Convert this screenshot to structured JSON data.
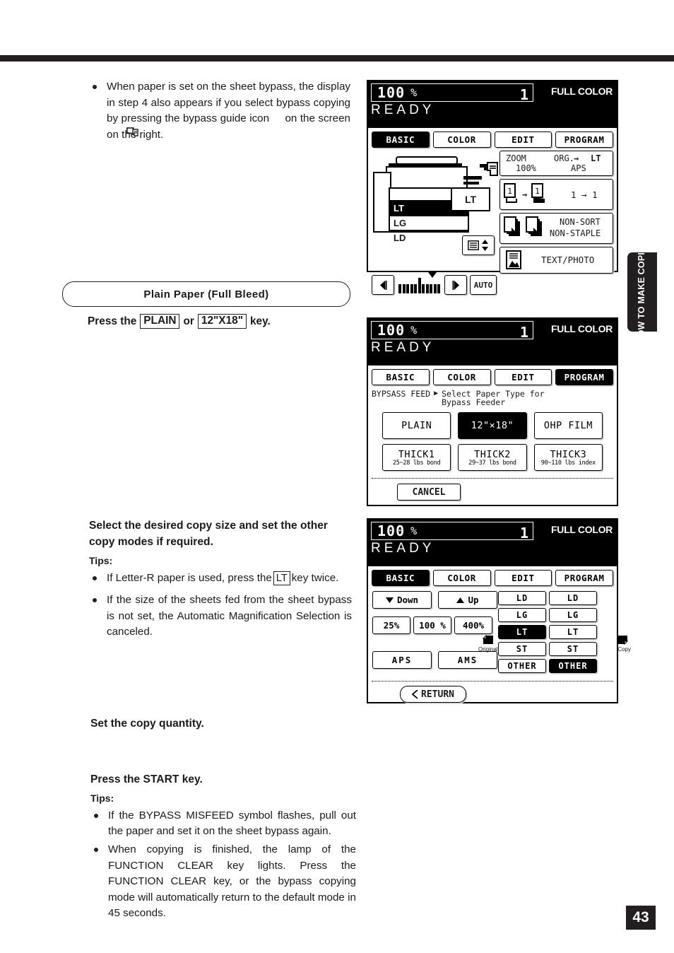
{
  "page": {
    "number": "43",
    "side_tab": "HOW TO MAKE COPIES"
  },
  "notes": {
    "note1": "When paper is set on the sheet bypass, the display in step 4 also appears if you select bypass copying by pressing the bypass guide icon     on the screen on the right."
  },
  "section": {
    "pill_title": "Plain Paper (Full Bleed)",
    "press_prefix": "Press the",
    "key1": "PLAIN",
    "press_or": "or",
    "key2": "12\"X18\"",
    "press_suffix": "key."
  },
  "steps": {
    "select_size": {
      "heading": "Select the desired copy size and set the other copy modes if required.",
      "tips_label": "Tips:",
      "tip1_a": "If Letter-R paper is used, press the",
      "tip1_key": "LT",
      "tip1_b": "key twice.",
      "tip2": "If the size of the sheets fed from the sheet bypass is not set, the Automatic Magnification Selection is canceled."
    },
    "quantity": {
      "heading": "Set the copy quantity."
    },
    "start": {
      "heading": "Press the START key.",
      "tips_label": "Tips:",
      "tip1": "If the BYPASS MISFEED symbol flashes, pull out the paper and set it on the sheet bypass again.",
      "tip2": "When copying is finished, the lamp of the FUNCTION CLEAR key lights.  Press the FUNCTION CLEAR key, or the bypass copying mode will automatically return to the default mode in 45 seconds."
    }
  },
  "lcd_common": {
    "ratio": "100",
    "percent": "%",
    "quantity": "1",
    "color_mode": "FULL COLOR",
    "status": "READY",
    "tabs": [
      "BASIC",
      "COLOR",
      "EDIT",
      "PROGRAM"
    ]
  },
  "lcd1": {
    "selected_tab": "BASIC",
    "trays": [
      "",
      "LT",
      "LG",
      "LD"
    ],
    "selected_tray": "LT",
    "bypass_size": "LT",
    "zoom_label": "ZOOM",
    "zoom_value": "100%",
    "org_label": "ORG.",
    "org_arrow": "→",
    "org_target": "LT",
    "aps_label": "APS",
    "duplex_value": "1 → 1",
    "duplex_icon_left": "1",
    "duplex_icon_right": "1",
    "finisher_line1": "NON-SORT",
    "finisher_line2": "NON-STAPLE",
    "orig_mode": "TEXT/PHOTO",
    "auto_label": "AUTO"
  },
  "lcd2": {
    "selected_tab": "PROGRAM",
    "breadcrumb": "BYPSASS FEED",
    "breadcrumb_arrow": "▶",
    "breadcrumb_detail_line1": "Select Paper Type for",
    "breadcrumb_detail_line2": "Bypass Feeder",
    "paper_types": [
      {
        "label": "PLAIN",
        "sub": "",
        "selected": false
      },
      {
        "label": "12\"×18\"",
        "sub": "",
        "selected": true
      },
      {
        "label": "OHP FILM",
        "sub": "",
        "selected": false
      },
      {
        "label": "THICK1",
        "sub": "25~28 lbs bond",
        "selected": false
      },
      {
        "label": "THICK2",
        "sub": "29~37 lbs bond",
        "selected": false
      },
      {
        "label": "THICK3",
        "sub": "90~110 lbs index",
        "selected": false
      }
    ],
    "cancel": "CANCEL"
  },
  "lcd3": {
    "selected_tab": "BASIC",
    "down": "Down",
    "up": "Up",
    "zoom_presets": [
      "25%",
      "100 %",
      "400%"
    ],
    "aps": "APS",
    "ams": "AMS",
    "original_label": "Original",
    "copy_label": "Copy",
    "original_sizes": [
      {
        "label": "LD",
        "selected": false
      },
      {
        "label": "LG",
        "selected": false
      },
      {
        "label": "LT",
        "selected": true
      },
      {
        "label": "ST",
        "selected": false
      },
      {
        "label": "OTHER",
        "selected": false
      }
    ],
    "copy_sizes": [
      {
        "label": "LD",
        "selected": false
      },
      {
        "label": "LG",
        "selected": false
      },
      {
        "label": "LT",
        "selected": false
      },
      {
        "label": "ST",
        "selected": false
      },
      {
        "label": "OTHER",
        "selected": true
      }
    ],
    "return": "RETURN"
  }
}
